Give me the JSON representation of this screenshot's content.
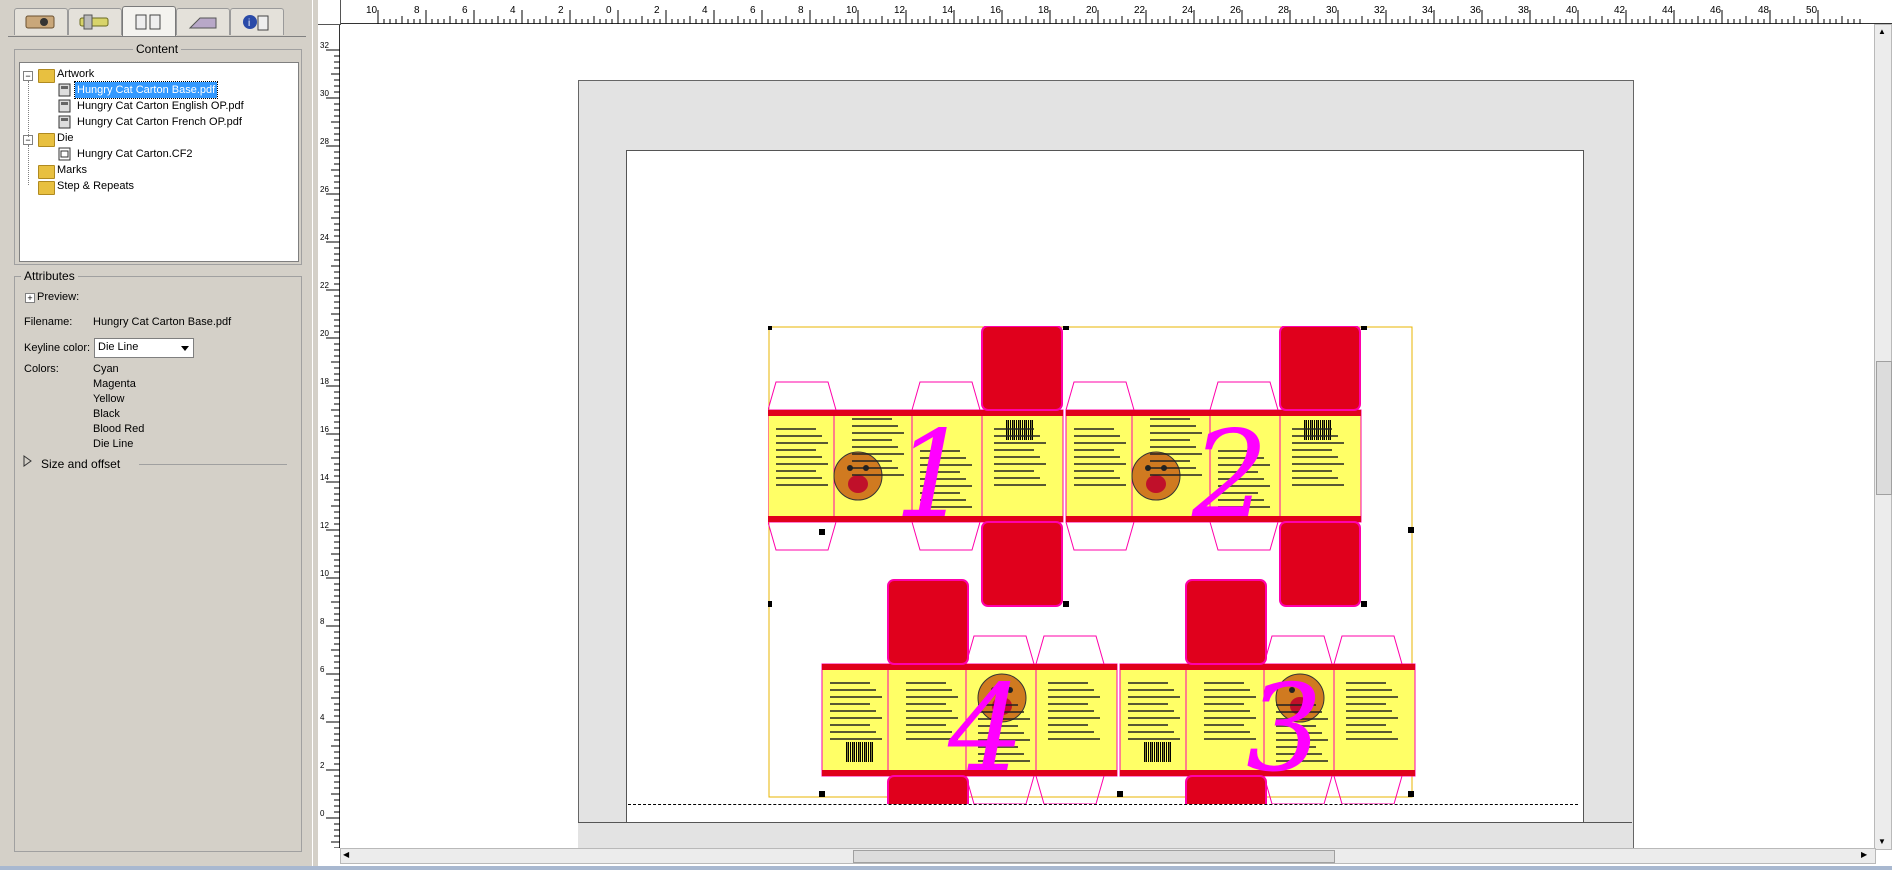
{
  "toolbar_tabs": [
    {
      "icon": "job-info-icon"
    },
    {
      "icon": "tools-icon"
    },
    {
      "icon": "content-icon"
    },
    {
      "icon": "press-icon"
    },
    {
      "icon": "info-icon"
    }
  ],
  "content": {
    "title": "Content",
    "tree": [
      {
        "label": "Artwork",
        "type": "folder",
        "expanded": true
      },
      {
        "label": "Hungry Cat Carton Base.pdf",
        "type": "file",
        "selected": true
      },
      {
        "label": "Hungry Cat Carton English OP.pdf",
        "type": "file"
      },
      {
        "label": "Hungry Cat Carton French OP.pdf",
        "type": "file"
      },
      {
        "label": "Die",
        "type": "folder",
        "expanded": true
      },
      {
        "label": "Hungry Cat Carton.CF2",
        "type": "die-file"
      },
      {
        "label": "Marks",
        "type": "folder"
      },
      {
        "label": "Step & Repeats",
        "type": "folder"
      }
    ]
  },
  "attributes": {
    "title": "Attributes",
    "preview_label": "Preview:",
    "filename_label": "Filename:",
    "filename_value": "Hungry Cat Carton Base.pdf",
    "keyline_label": "Keyline color:",
    "keyline_value": "Die Line",
    "colors_label": "Colors:",
    "colors": [
      "Cyan",
      "Magenta",
      "Yellow",
      "Black",
      "Blood Red",
      "Die Line"
    ],
    "size_offset_label": "Size and offset"
  },
  "ruler": {
    "top_labels": [
      "10",
      "8",
      "6",
      "4",
      "2",
      "0",
      "2",
      "4",
      "6",
      "8",
      "10",
      "12",
      "14",
      "16",
      "18",
      "20",
      "22",
      "24",
      "26",
      "28",
      "30",
      "32",
      "34",
      "36",
      "38",
      "40",
      "42",
      "44",
      "46",
      "48",
      "50"
    ],
    "left_labels": [
      "32",
      "30",
      "28",
      "26",
      "24",
      "22",
      "20",
      "18",
      "16",
      "14",
      "12",
      "10",
      "8",
      "6",
      "4",
      "2",
      "0"
    ]
  },
  "canvas": {
    "carton_numbers": [
      "1",
      "2",
      "3",
      "4"
    ],
    "colors": {
      "die_line": "#ff00aa",
      "bleed": "#e8b400",
      "panel_red": "#e0001c",
      "panel_yellow": "#ffff66",
      "number": "#ff00ff"
    }
  }
}
